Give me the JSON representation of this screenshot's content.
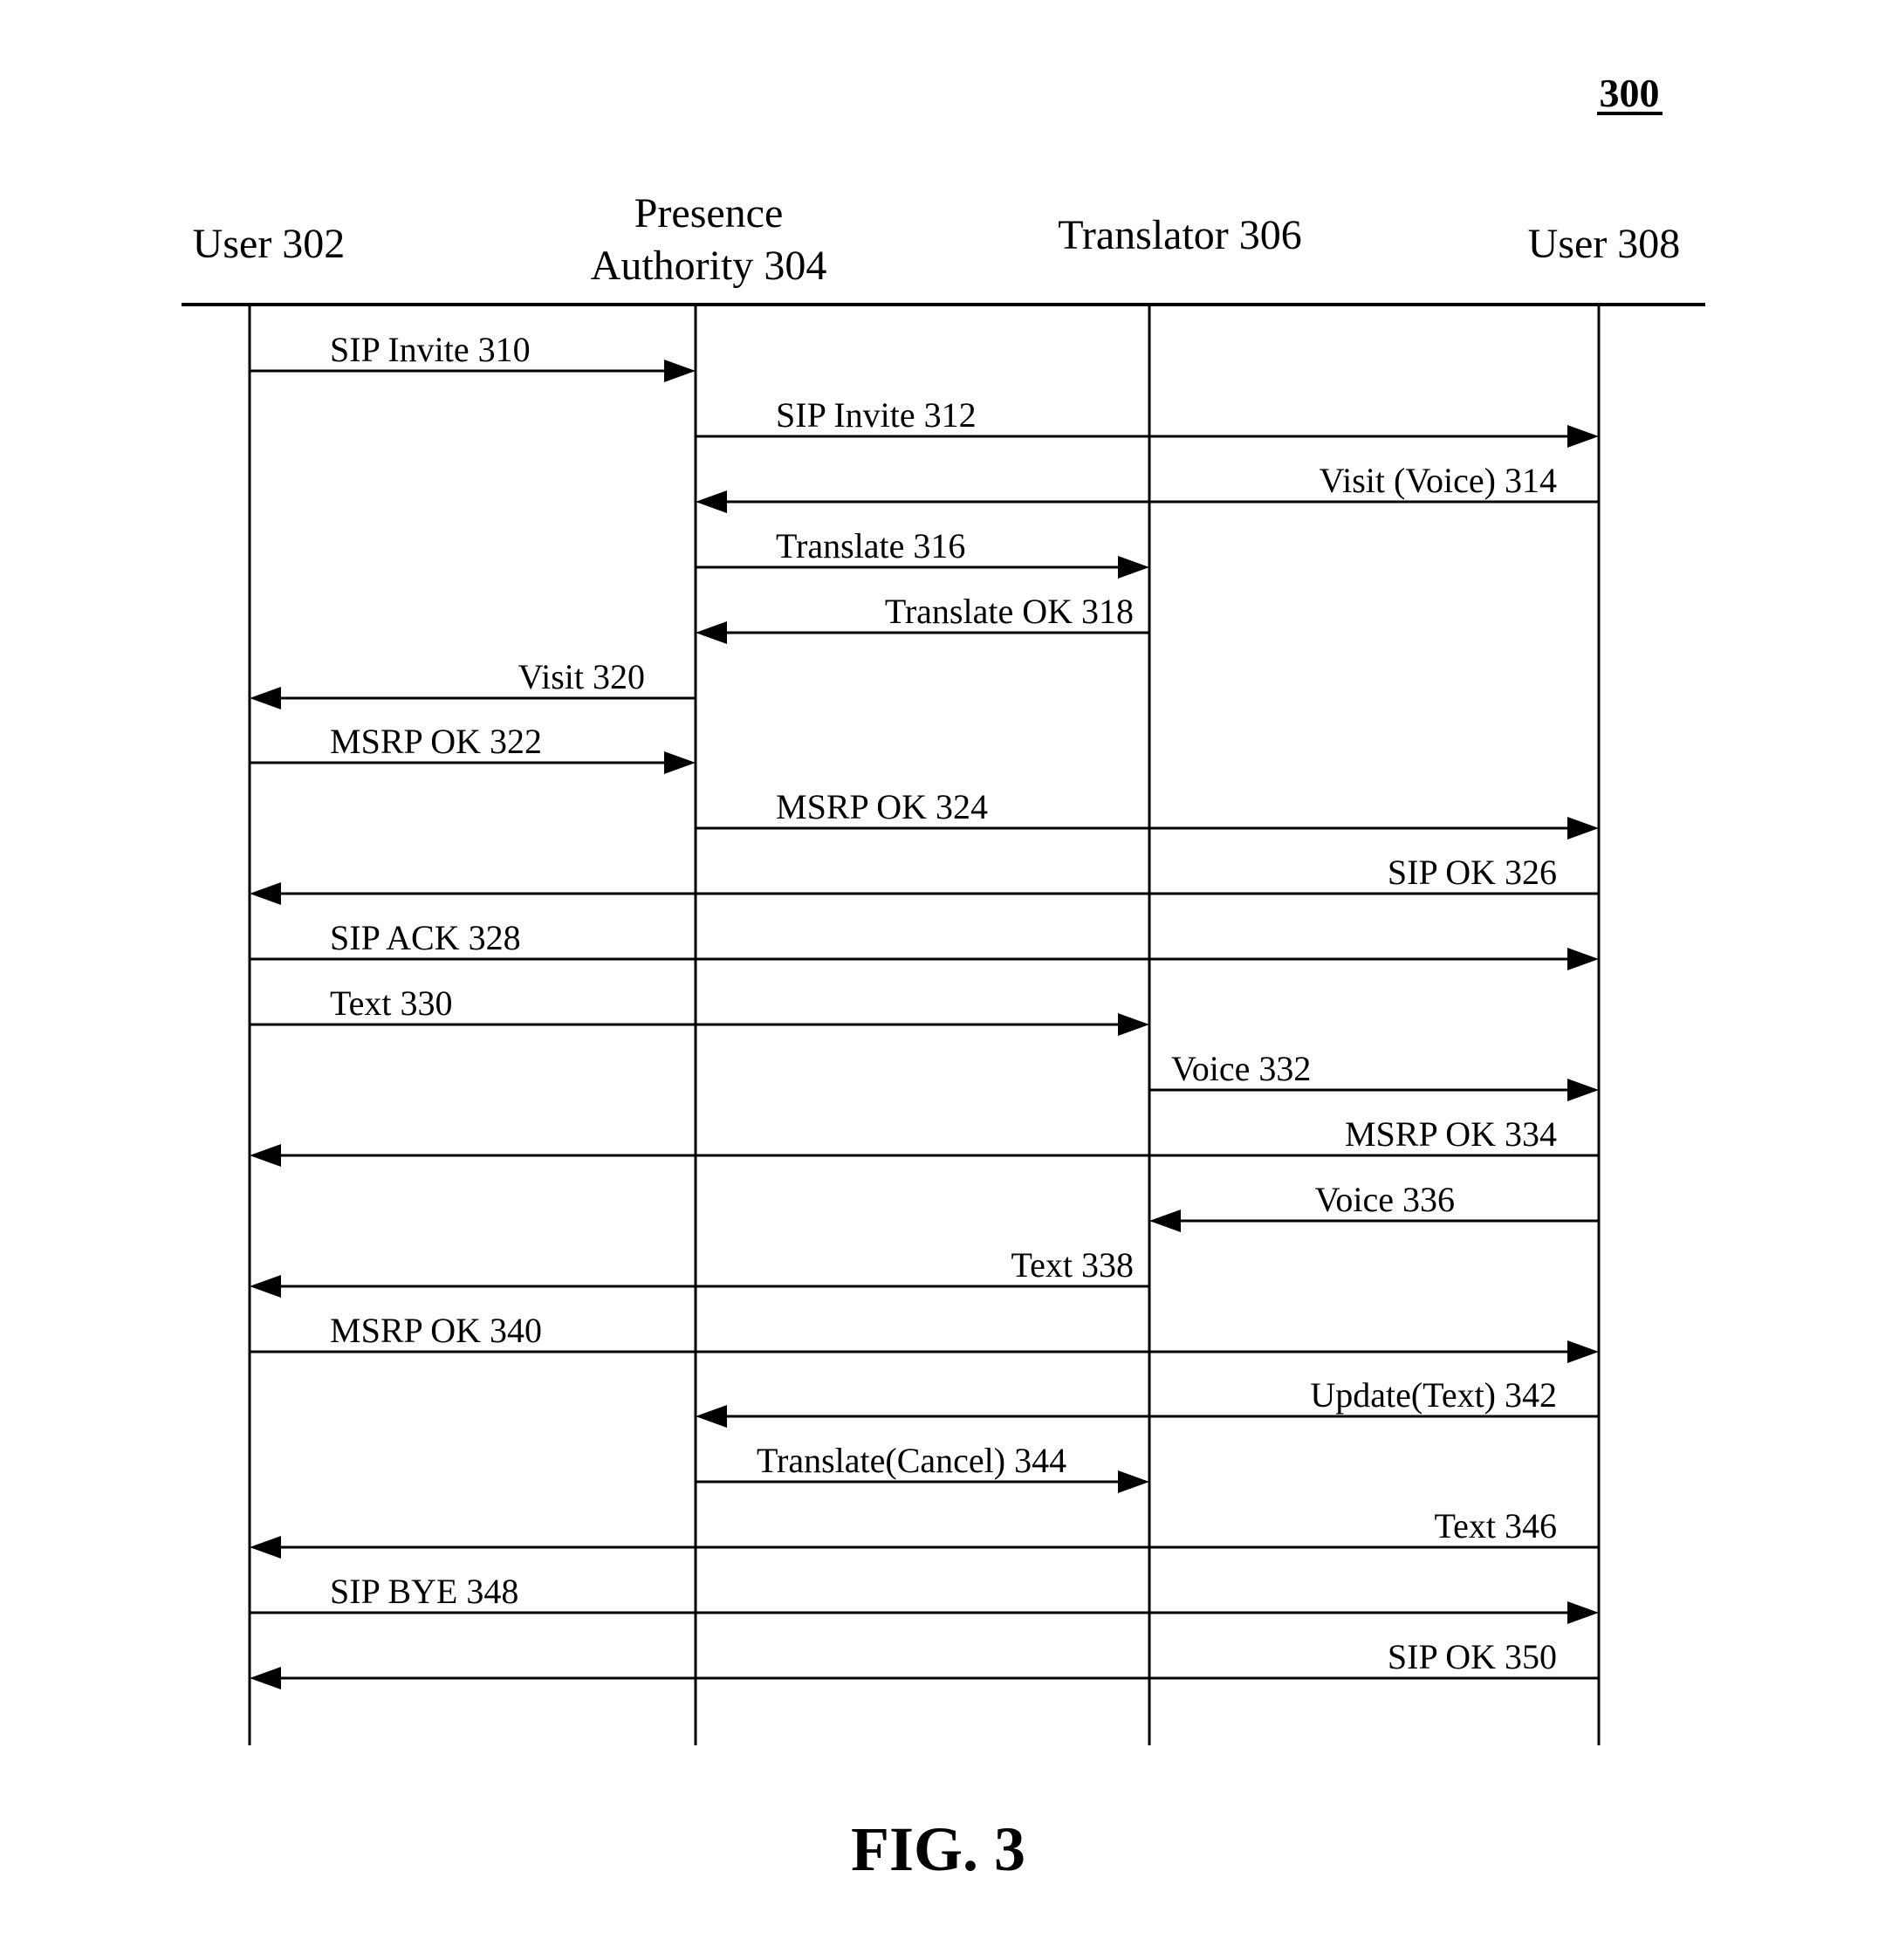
{
  "figure": {
    "reference_number": "300",
    "caption": "FIG. 3"
  },
  "participants": [
    {
      "id": "user302",
      "label_lines": [
        "User 302"
      ]
    },
    {
      "id": "pa304",
      "label_lines": [
        "Presence",
        "Authority 304"
      ]
    },
    {
      "id": "tr306",
      "label_lines": [
        "Translator 306"
      ]
    },
    {
      "id": "user308",
      "label_lines": [
        "User 308"
      ]
    }
  ],
  "messages": [
    {
      "label": "SIP Invite 310",
      "from": 0,
      "to": 1
    },
    {
      "label": "SIP Invite 312",
      "from": 1,
      "to": 3
    },
    {
      "label": "Visit (Voice) 314",
      "from": 3,
      "to": 1
    },
    {
      "label": "Translate 316",
      "from": 1,
      "to": 2
    },
    {
      "label": "Translate OK 318",
      "from": 2,
      "to": 1
    },
    {
      "label": "Visit 320",
      "from": 1,
      "to": 0
    },
    {
      "label": "MSRP OK 322",
      "from": 0,
      "to": 1
    },
    {
      "label": "MSRP OK 324",
      "from": 1,
      "to": 3
    },
    {
      "label": "SIP OK 326",
      "from": 3,
      "to": 0
    },
    {
      "label": "SIP ACK 328",
      "from": 0,
      "to": 3
    },
    {
      "label": "Text 330",
      "from": 0,
      "to": 2
    },
    {
      "label": "Voice 332",
      "from": 2,
      "to": 3
    },
    {
      "label": "MSRP OK 334",
      "from": 3,
      "to": 0
    },
    {
      "label": "Voice 336",
      "from": 3,
      "to": 2
    },
    {
      "label": "Text 338",
      "from": 2,
      "to": 0
    },
    {
      "label": "MSRP OK 340",
      "from": 0,
      "to": 3
    },
    {
      "label": "Update(Text) 342",
      "from": 3,
      "to": 1
    },
    {
      "label": "Translate(Cancel) 344",
      "from": 1,
      "to": 2
    },
    {
      "label": "Text 346",
      "from": 3,
      "to": 0
    },
    {
      "label": "SIP BYE 348",
      "from": 0,
      "to": 3
    },
    {
      "label": "SIP OK 350",
      "from": 3,
      "to": 0
    }
  ]
}
